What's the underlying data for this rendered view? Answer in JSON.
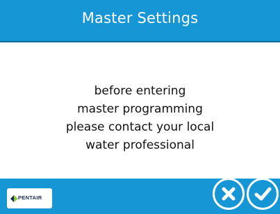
{
  "header": {
    "title": "Master Settings"
  },
  "message": {
    "lines": [
      "before entering",
      "master programming",
      "please contact your local",
      "water professional"
    ]
  },
  "footer": {
    "logo_text": "PENTAIR"
  },
  "icons": {
    "cancel": "close-icon",
    "confirm": "checkmark-icon",
    "logo_mark": "pentair-diamond-icon"
  },
  "colors": {
    "accent": "#1796d6",
    "text": "#111111",
    "logo": "#1a2b55"
  }
}
